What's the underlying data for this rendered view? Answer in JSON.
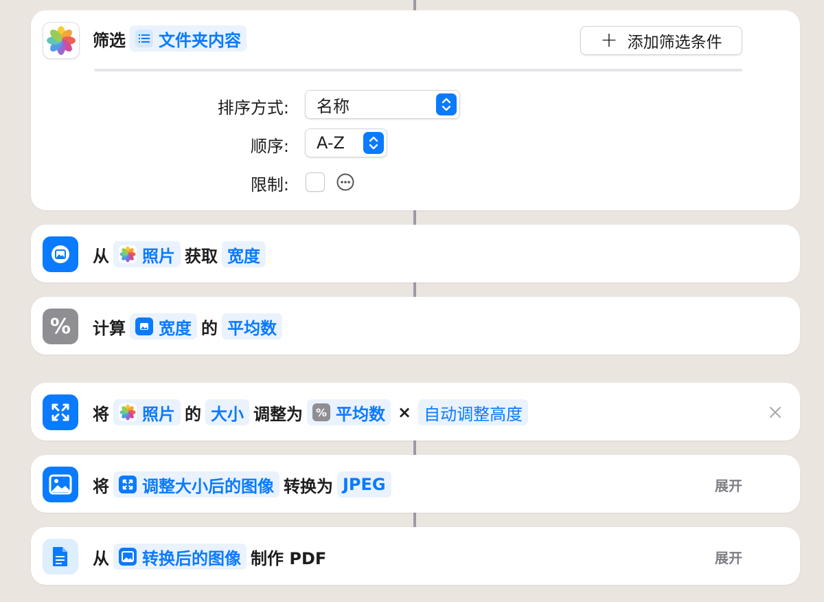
{
  "connectors": {},
  "filter_action": {
    "verb": "筛选",
    "source_token": "文件夹内容",
    "add_filter_label": "添加筛选条件",
    "options": {
      "sort_label": "排序方式:",
      "sort_value": "名称",
      "order_label": "顺序:",
      "order_value": "A-Z",
      "limit_label": "限制:",
      "limit_checked": false
    }
  },
  "get_details": {
    "word_from": "从",
    "token_photos": "照片",
    "word_get": "获取",
    "token_width": "宽度"
  },
  "calculate": {
    "word_calc": "计算",
    "token_width": "宽度",
    "word_of": "的",
    "token_average": "平均数"
  },
  "resize": {
    "word_will": "将",
    "token_photos": "照片",
    "word_of": "的",
    "token_size": "大小",
    "word_adjust": "调整为",
    "token_average": "平均数",
    "times": "×",
    "token_auto_height": "自动调整高度"
  },
  "convert": {
    "word_will": "将",
    "token_resized": "调整大小后的图像",
    "word_convert": "转换为",
    "token_format": "JPEG",
    "expand_label": "展开"
  },
  "make_pdf": {
    "word_from": "从",
    "token_converted": "转换后的图像",
    "word_make": "制作 PDF",
    "expand_label": "展开"
  },
  "colors": {
    "accent": "#0a7aff",
    "token_bg": "#eaf2fd",
    "card_bg": "#ffffff",
    "page_bg": "#ebe5e0",
    "calc_icon": "#8e8e93",
    "pdf_icon_bg": "#ddeefd"
  }
}
